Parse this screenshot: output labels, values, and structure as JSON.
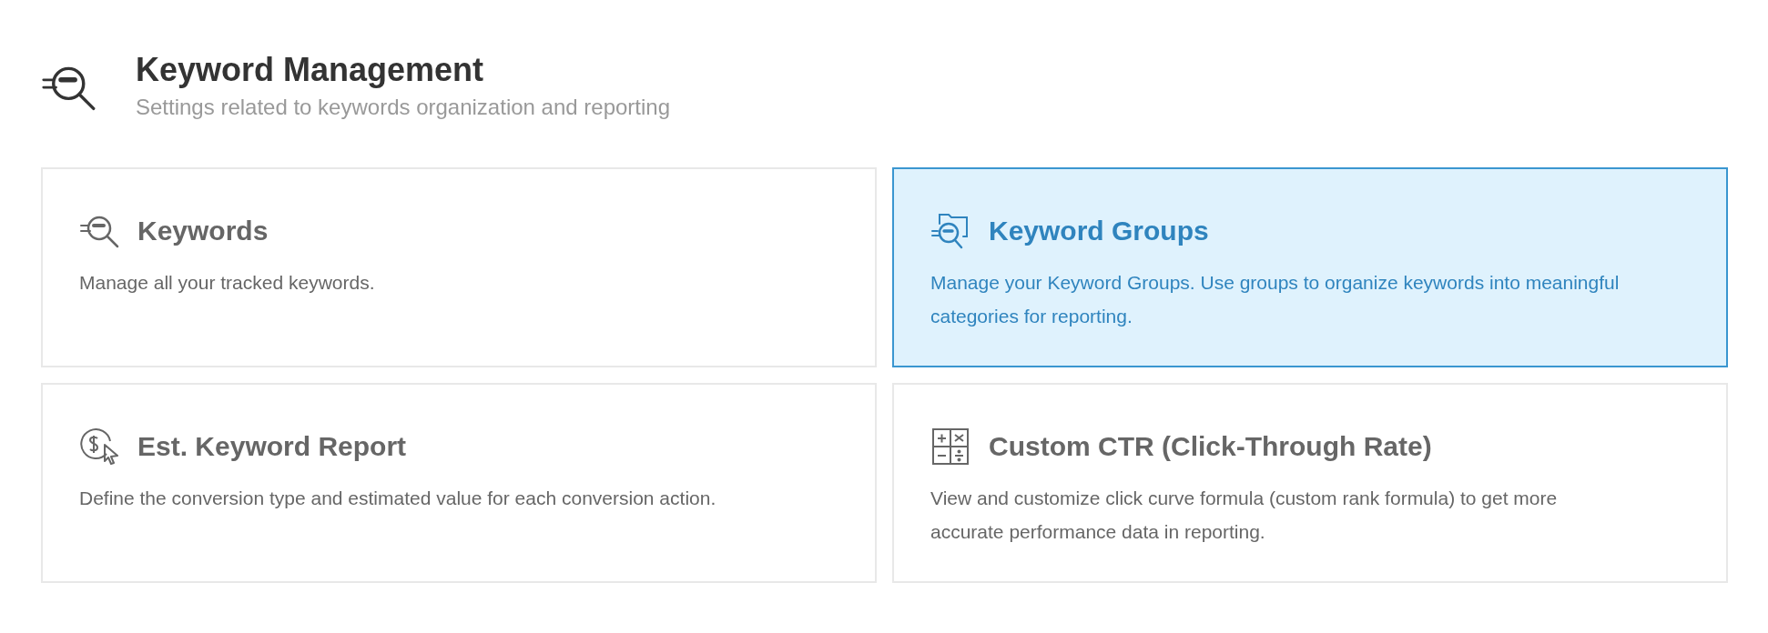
{
  "header": {
    "title": "Keyword Management",
    "subtitle": "Settings related to keywords organization and reporting"
  },
  "cards": [
    {
      "kind": "keywords",
      "title": "Keywords",
      "description": "Manage all your tracked keywords.",
      "selected": false
    },
    {
      "kind": "groups",
      "title": "Keyword Groups",
      "description": "Manage your Keyword Groups. Use groups to organize keywords into meaningful categories for reporting.",
      "selected": true
    },
    {
      "kind": "value",
      "title": "Est. Keyword Report",
      "description": "Define the conversion type and estimated value for each conversion action.",
      "selected": false
    },
    {
      "kind": "calculator",
      "title": "Custom CTR (Click-Through Rate)",
      "description": "View and customize click curve formula (custom rank formula) to get more accurate performance data in reporting.",
      "selected": false
    }
  ]
}
